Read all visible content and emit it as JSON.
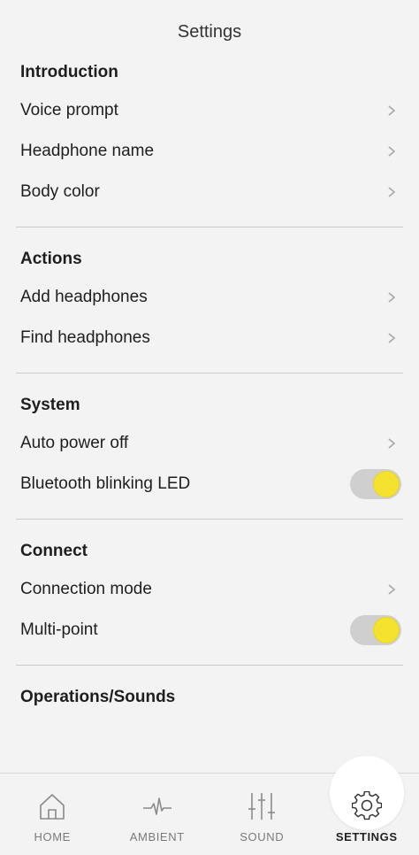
{
  "header": {
    "title": "Settings"
  },
  "sections": [
    {
      "title": "Introduction",
      "rows": [
        {
          "label": "Voice prompt",
          "control": "chevron"
        },
        {
          "label": "Headphone name",
          "control": "chevron"
        },
        {
          "label": "Body color",
          "control": "chevron"
        }
      ]
    },
    {
      "title": "Actions",
      "rows": [
        {
          "label": "Add headphones",
          "control": "chevron"
        },
        {
          "label": "Find headphones",
          "control": "chevron"
        }
      ]
    },
    {
      "title": "System",
      "rows": [
        {
          "label": "Auto power off",
          "control": "chevron"
        },
        {
          "label": "Bluetooth blinking LED",
          "control": "toggle",
          "on": true
        }
      ]
    },
    {
      "title": "Connect",
      "rows": [
        {
          "label": "Connection mode",
          "control": "chevron"
        },
        {
          "label": "Multi-point",
          "control": "toggle",
          "on": true
        }
      ]
    },
    {
      "title": "Operations/Sounds",
      "rows": []
    }
  ],
  "tabs": [
    {
      "label": "HOME",
      "icon": "home-icon",
      "active": false
    },
    {
      "label": "AMBIENT",
      "icon": "waveform-icon",
      "active": false
    },
    {
      "label": "SOUND",
      "icon": "equalizer-icon",
      "active": false
    },
    {
      "label": "SETTINGS",
      "icon": "gear-icon",
      "active": true
    }
  ],
  "colors": {
    "background": "#f3f3f3",
    "toggle_on_knob": "#f5e22e",
    "toggle_track": "#cfcfcf",
    "divider": "#c9c9c9"
  }
}
